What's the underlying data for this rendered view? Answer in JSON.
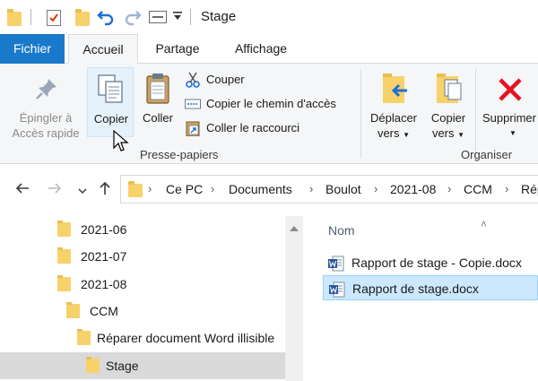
{
  "window": {
    "title": "Stage"
  },
  "quick_access": {
    "icons": [
      "folder-icon",
      "properties-check-icon",
      "new-folder-icon",
      "undo-icon",
      "redo-icon",
      "rename-icon",
      "customize-dropdown-icon"
    ]
  },
  "tabs": [
    {
      "label": "Fichier"
    },
    {
      "label": "Accueil"
    },
    {
      "label": "Partage"
    },
    {
      "label": "Affichage"
    }
  ],
  "ribbon": {
    "pin": {
      "line1": "Épingler à",
      "line2": "Accès rapide"
    },
    "copy": {
      "label": "Copier"
    },
    "paste": {
      "label": "Coller"
    },
    "cut": {
      "label": "Couper"
    },
    "copy_path": {
      "label": "Copier le chemin d'accès"
    },
    "paste_shortcut": {
      "label": "Coller le raccourci"
    },
    "clipboard_group": "Presse-papiers",
    "move_to": {
      "line1": "Déplacer",
      "line2": "vers"
    },
    "copy_to": {
      "line1": "Copier",
      "line2": "vers"
    },
    "delete": {
      "label": "Supprimer"
    },
    "organize_group": "Organiser",
    "colors": {
      "file_tab": "#1979ca",
      "delete_x": "#e81123",
      "folder": "#f7d26b"
    }
  },
  "address": {
    "crumbs": [
      "Ce PC",
      "Documents",
      "Boulot",
      "2021-08",
      "CCM",
      "Réparer"
    ]
  },
  "tree": {
    "items": [
      {
        "label": "2021-06"
      },
      {
        "label": "2021-07"
      },
      {
        "label": "2021-08"
      },
      {
        "label": "CCM"
      },
      {
        "label": "Réparer document Word illisible"
      },
      {
        "label": "Stage"
      }
    ]
  },
  "files": {
    "column_header": "Nom",
    "items": [
      {
        "name": "Rapport de stage - Copie.docx",
        "selected": false
      },
      {
        "name": "Rapport de stage.docx",
        "selected": true
      }
    ]
  }
}
